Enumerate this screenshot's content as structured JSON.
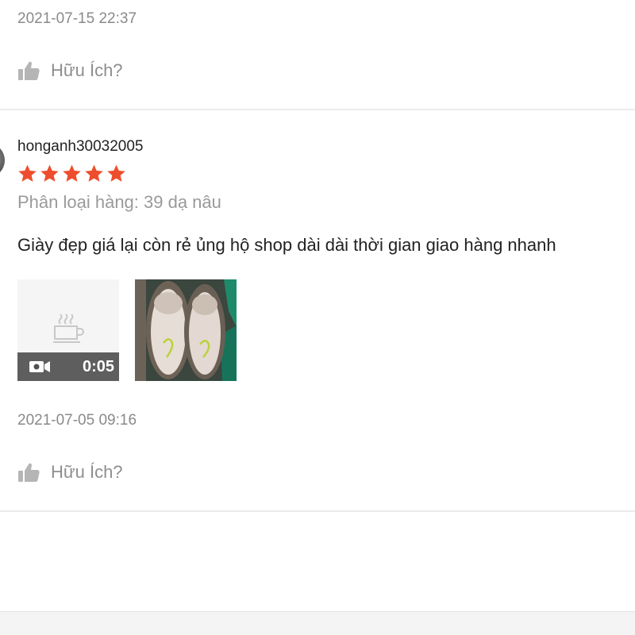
{
  "previous_review": {
    "timestamp": "2021-07-15 22:37",
    "helpful_label": "Hữu Ích?"
  },
  "review": {
    "username": "honganh30032005",
    "rating": 5,
    "rating_max": 5,
    "variant": "Phân loại hàng: 39 dạ nâu",
    "text": "Giày đẹp giá lại còn rẻ ủng hộ shop dài dài thời gian giao hàng nhanh",
    "media": {
      "video_duration": "0:05"
    },
    "timestamp": "2021-07-05 09:16",
    "helpful_label": "Hữu Ích?"
  },
  "colors": {
    "star": "#ee4d2d",
    "muted_text": "#8a8a8a",
    "divider": "#ebebeb"
  },
  "icons": {
    "helpful": "thumbs-up-icon",
    "video_placeholder": "coffee-cup-icon",
    "video_badge": "video-camera-icon",
    "rating": "star-icon"
  }
}
